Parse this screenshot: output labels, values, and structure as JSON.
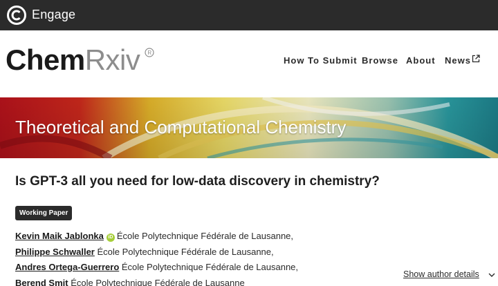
{
  "topbar": {
    "brand": "Engage",
    "background": "#2b2b2b"
  },
  "header": {
    "logo_primary": "Chem",
    "logo_secondary": "Rxiv",
    "logo_mark": "®",
    "nav": [
      {
        "label": "How To Submit"
      },
      {
        "label": "Browse"
      },
      {
        "label": "About"
      },
      {
        "label": "News",
        "icon": "external-link-icon"
      }
    ]
  },
  "banner": {
    "title": "Theoretical and Computational Chemistry"
  },
  "article": {
    "title": "Is GPT-3 all you need for low-data discovery in chemistry?",
    "badge": "Working Paper",
    "authors": [
      {
        "name": "Kevin Maik Jablonka",
        "orcid": true,
        "affiliation": "École Polytechnique Fédérale de Lausanne,"
      },
      {
        "name": "Philippe Schwaller",
        "orcid": false,
        "affiliation": "École Polytechnique Fédérale de Lausanne,"
      },
      {
        "name": "Andres Ortega-Guerrero",
        "orcid": false,
        "affiliation": "École Polytechnique Fédérale de Lausanne,"
      },
      {
        "name": "Berend Smit",
        "orcid": false,
        "affiliation": "École Polytechnique Fédérale de Lausanne"
      }
    ],
    "show_details": "Show author details",
    "orcid_label": "iD"
  },
  "colors": {
    "accent_orcid": "#a6ce39",
    "badge_bg": "#2b2b2b"
  }
}
